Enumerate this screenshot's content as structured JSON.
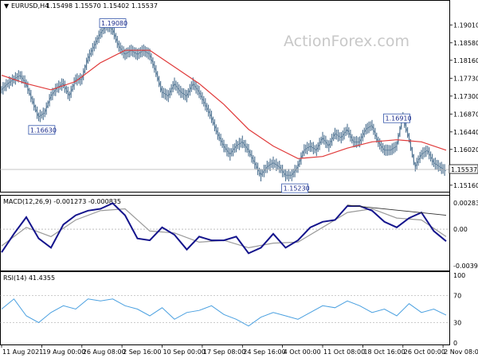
{
  "header": {
    "symbol": "EURUSD,H4",
    "ohlc": "1.15498 1.15570 1.15402 1.15537"
  },
  "watermark": "ActionForex.com",
  "colors": {
    "price": "#4a6f8f",
    "sma": "#e03a3a",
    "macd": "#14148c",
    "signal": "#9a9a9a",
    "rsi": "#4aa0e0",
    "trendline": "#303030",
    "grid": "#c0c0c0"
  },
  "chart_data": [
    {
      "type": "line",
      "panel": "price",
      "title": "EURUSD,H4",
      "ylim": [
        1.1506,
        1.1934
      ],
      "y_ticks": [
        "1.19010",
        "1.18580",
        "1.18160",
        "1.17730",
        "1.17300",
        "1.16870",
        "1.16440",
        "1.16020",
        "1.15590",
        "1.15160"
      ],
      "current_label": "1.15537",
      "annotations": [
        {
          "text": "1.16630",
          "anchor_x": 13,
          "value": 1.1663
        },
        {
          "text": "1.19080",
          "anchor_x": 36,
          "value": 1.1908
        },
        {
          "text": "1.15230",
          "anchor_x": 95,
          "value": 1.1523
        },
        {
          "text": "1.16910",
          "anchor_x": 128,
          "value": 1.1691
        }
      ],
      "series": [
        {
          "kind": "close",
          "x": [
            0,
            2,
            4,
            6,
            8,
            10,
            12,
            14,
            16,
            18,
            20,
            22,
            24,
            26,
            28,
            30,
            32,
            34,
            36,
            38,
            40,
            42,
            44,
            46,
            48,
            50,
            52,
            54,
            56,
            58,
            60,
            62,
            64,
            66,
            68,
            70,
            72,
            74,
            76,
            78,
            80,
            82,
            84,
            86,
            88,
            90,
            92,
            94,
            96,
            98,
            100,
            102,
            104,
            106,
            108,
            110,
            112,
            114,
            116,
            118,
            120,
            122,
            124,
            126,
            128,
            130,
            132,
            134,
            136,
            138,
            140,
            142,
            144
          ],
          "values": [
            1.1745,
            1.176,
            1.177,
            1.178,
            1.176,
            1.172,
            1.168,
            1.169,
            1.173,
            1.175,
            1.176,
            1.173,
            1.177,
            1.177,
            1.182,
            1.185,
            1.188,
            1.19,
            1.189,
            1.185,
            1.183,
            1.184,
            1.183,
            1.184,
            1.183,
            1.179,
            1.174,
            1.173,
            1.176,
            1.174,
            1.173,
            1.176,
            1.174,
            1.171,
            1.168,
            1.164,
            1.161,
            1.159,
            1.161,
            1.162,
            1.16,
            1.157,
            1.154,
            1.156,
            1.157,
            1.156,
            1.154,
            1.154,
            1.156,
            1.16,
            1.161,
            1.16,
            1.163,
            1.161,
            1.164,
            1.163,
            1.165,
            1.162,
            1.162,
            1.165,
            1.166,
            1.162,
            1.16,
            1.16,
            1.161,
            1.168,
            1.163,
            1.156,
            1.159,
            1.16,
            1.157,
            1.156,
            1.155
          ]
        },
        {
          "kind": "sma",
          "x": [
            0,
            8,
            16,
            24,
            32,
            40,
            48,
            56,
            64,
            72,
            80,
            88,
            96,
            104,
            112,
            120,
            128,
            136,
            144
          ],
          "values": [
            1.178,
            1.176,
            1.1745,
            1.1765,
            1.181,
            1.184,
            1.184,
            1.18,
            1.176,
            1.171,
            1.165,
            1.161,
            1.158,
            1.1585,
            1.1605,
            1.162,
            1.1625,
            1.162,
            1.16
          ]
        }
      ]
    },
    {
      "type": "line",
      "panel": "macd",
      "title": "MACD(12,26,9) -0.001273 -0.000835",
      "ylim": [
        -0.0042,
        0.0031
      ],
      "y_ticks": [
        "0.00283",
        "0.00",
        "-0.003939"
      ],
      "trendline": {
        "x": [
          112,
          144
        ],
        "values": [
          0.0026,
          0.0015
        ]
      },
      "series": [
        {
          "name": "MACD",
          "x": [
            0,
            4,
            8,
            12,
            16,
            20,
            24,
            28,
            32,
            36,
            40,
            44,
            48,
            52,
            56,
            60,
            64,
            68,
            72,
            76,
            80,
            84,
            88,
            92,
            96,
            100,
            104,
            108,
            112,
            116,
            120,
            124,
            128,
            132,
            136,
            140,
            144
          ],
          "values": [
            -0.0025,
            -0.0005,
            0.0013,
            -0.001,
            -0.002,
            0.0005,
            0.0015,
            0.002,
            0.0022,
            0.0028,
            0.0015,
            -0.001,
            -0.0012,
            0.0002,
            -0.0006,
            -0.0022,
            -0.0008,
            -0.0012,
            -0.0012,
            -0.0008,
            -0.0026,
            -0.002,
            -0.0005,
            -0.002,
            -0.0012,
            0.0002,
            0.0008,
            0.001,
            0.0025,
            0.0025,
            0.002,
            0.0008,
            0.0002,
            0.0012,
            0.0018,
            -0.0002,
            -0.0013
          ]
        },
        {
          "name": "Signal",
          "x": [
            0,
            8,
            16,
            24,
            32,
            40,
            48,
            56,
            64,
            72,
            80,
            88,
            96,
            104,
            112,
            120,
            128,
            136,
            144
          ],
          "values": [
            -0.0018,
            0.0002,
            -0.0008,
            0.001,
            0.002,
            0.0022,
            -0.0002,
            -0.0004,
            -0.0014,
            -0.0012,
            -0.002,
            -0.0015,
            -0.0014,
            0.0002,
            0.0018,
            0.0022,
            0.0012,
            0.001,
            -0.0008
          ]
        }
      ]
    },
    {
      "type": "line",
      "panel": "rsi",
      "title": "RSI(14) 41.4355",
      "ylim": [
        0,
        100
      ],
      "y_ticks": [
        "100",
        "70",
        "30",
        "0"
      ],
      "series": [
        {
          "name": "RSI",
          "x": [
            0,
            4,
            8,
            12,
            16,
            20,
            24,
            28,
            32,
            36,
            40,
            44,
            48,
            52,
            56,
            60,
            64,
            68,
            72,
            76,
            80,
            84,
            88,
            92,
            96,
            100,
            104,
            108,
            112,
            116,
            120,
            124,
            128,
            132,
            136,
            140,
            144
          ],
          "values": [
            50,
            65,
            40,
            30,
            45,
            55,
            50,
            65,
            62,
            65,
            55,
            50,
            40,
            52,
            35,
            45,
            48,
            55,
            42,
            35,
            25,
            38,
            45,
            40,
            35,
            45,
            55,
            52,
            62,
            55,
            45,
            50,
            40,
            58,
            45,
            50,
            41
          ]
        }
      ]
    }
  ],
  "x_axis": {
    "labels": [
      "11 Aug 2021",
      "19 Aug 00:00",
      "26 Aug 08:00",
      "2 Sep 16:00",
      "10 Sep 00:00",
      "17 Sep 08:00",
      "24 Sep 16:00",
      "4 Oct 00:00",
      "11 Oct 08:00",
      "18 Oct 16:00",
      "26 Oct 00:00",
      "2 Nov 08:00"
    ],
    "label_x": [
      0,
      13,
      26,
      39,
      52,
      65,
      78,
      91,
      104,
      117,
      130,
      143
    ]
  }
}
